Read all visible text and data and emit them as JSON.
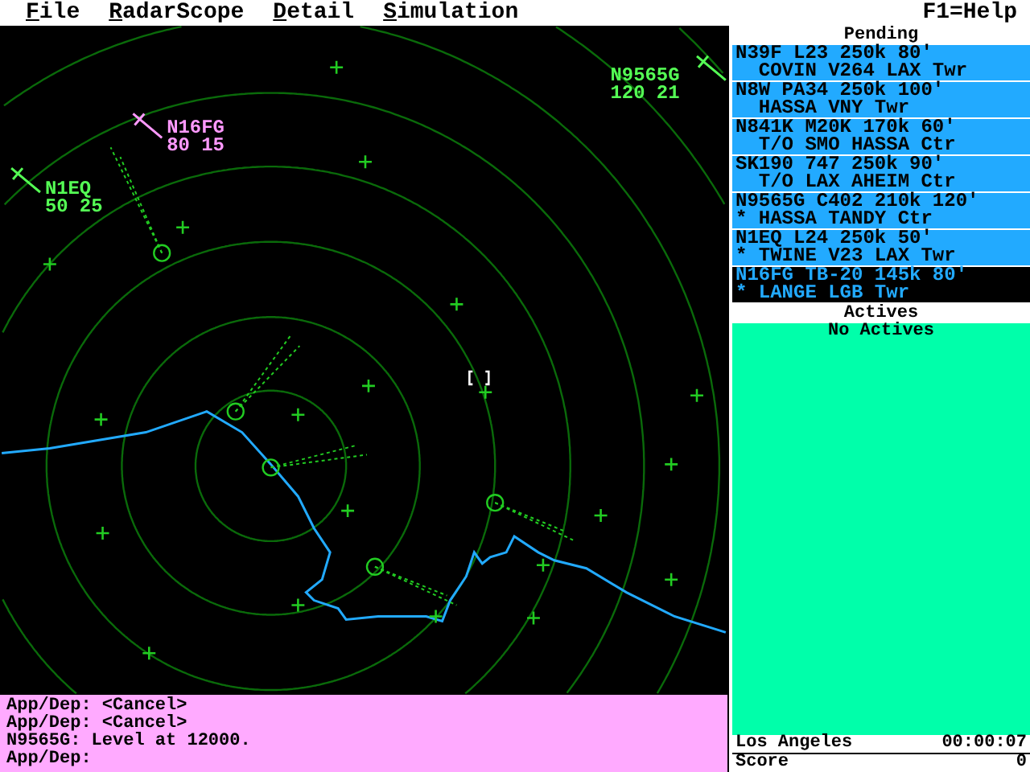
{
  "menu": {
    "items": [
      "File",
      "RadarScope",
      "Detail",
      "Simulation"
    ],
    "help": "F1=Help"
  },
  "radar": {
    "aircraft": [
      {
        "callsign": "N16FG",
        "data": "80 15",
        "selected": true
      },
      {
        "callsign": "N1EQ",
        "data": "50 25",
        "selected": false
      },
      {
        "callsign": "N9565G",
        "data": "120 21",
        "selected": false
      }
    ]
  },
  "messages": [
    "App/Dep: <Cancel>",
    "App/Dep: <Cancel>",
    "N9565G: Level at 12000.",
    "App/Dep:"
  ],
  "pending": {
    "title": "Pending",
    "strips": [
      {
        "line1": "N39F L23 250k 80'",
        "line2": "  COVIN V264 LAX Twr",
        "selected": false
      },
      {
        "line1": "N8W PA34 250k 100'",
        "line2": "  HASSA VNY Twr",
        "selected": false
      },
      {
        "line1": "N841K M20K 170k 60'",
        "line2": "  T/O SMO HASSA Ctr",
        "selected": false
      },
      {
        "line1": "SK190 747 250k 90'",
        "line2": "  T/O LAX AHEIM Ctr",
        "selected": false
      },
      {
        "line1": "N9565G C402 210k 120'",
        "line2": "* HASSA TANDY Ctr",
        "selected": false
      },
      {
        "line1": "N1EQ L24 250k 50'",
        "line2": "* TWINE V23 LAX Twr",
        "selected": false
      },
      {
        "line1": "N16FG TB-20 145k 80'",
        "line2": "* LANGE LGB Twr",
        "selected": true
      }
    ]
  },
  "actives": {
    "title": "Actives",
    "empty": "No Actives"
  },
  "status": {
    "location": "Los Angeles",
    "time": "00:00:07",
    "score_label": "Score",
    "score": "0"
  }
}
